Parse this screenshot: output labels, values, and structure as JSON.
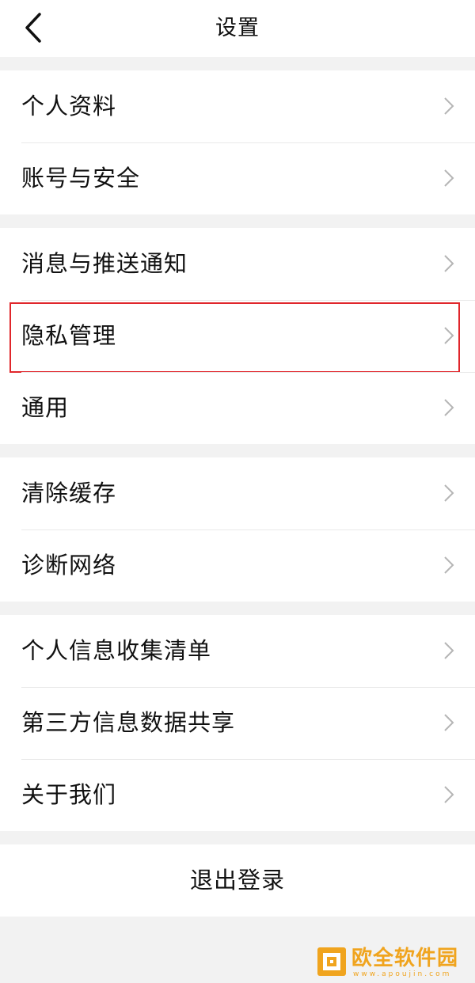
{
  "header": {
    "title": "设置"
  },
  "groups": [
    {
      "items": [
        {
          "label": "个人资料"
        },
        {
          "label": "账号与安全"
        }
      ]
    },
    {
      "items": [
        {
          "label": "消息与推送通知"
        },
        {
          "label": "隐私管理",
          "highlighted": true
        },
        {
          "label": "通用"
        }
      ]
    },
    {
      "items": [
        {
          "label": "清除缓存"
        },
        {
          "label": "诊断网络"
        }
      ]
    },
    {
      "items": [
        {
          "label": "个人信息收集清单"
        },
        {
          "label": "第三方信息数据共享"
        },
        {
          "label": "关于我们"
        }
      ]
    }
  ],
  "logout": {
    "label": "退出登录"
  },
  "watermark": {
    "title": "欧全软件园",
    "url": "www.apoujin.com"
  },
  "colors": {
    "highlight_border": "#e0262b",
    "chevron": "#b5b5b5",
    "background": "#f2f2f2",
    "watermark": "#f0a41e"
  },
  "icons": {
    "back": "chevron-left-icon",
    "row_arrow": "chevron-right-icon"
  }
}
